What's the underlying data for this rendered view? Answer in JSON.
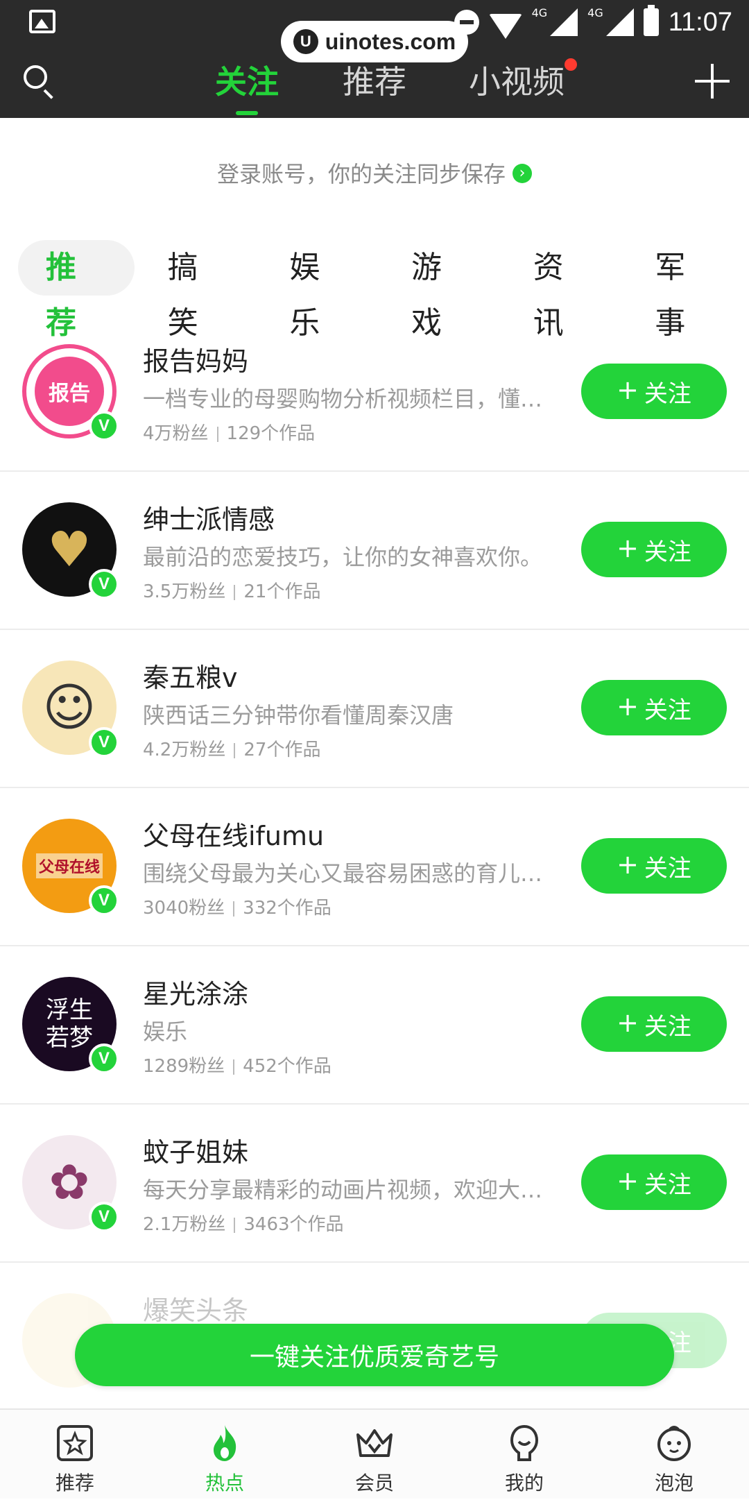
{
  "status_bar": {
    "time": "11:07",
    "net1": "4G",
    "net2": "4G"
  },
  "watermark": {
    "text": "uinotes.com"
  },
  "top_nav": {
    "tabs": [
      {
        "label": "关注",
        "active": true
      },
      {
        "label": "推荐",
        "active": false
      },
      {
        "label": "小视频",
        "active": false,
        "has_dot": true
      }
    ]
  },
  "login_banner": {
    "text": "登录账号，你的关注同步保存",
    "arrow": "›"
  },
  "categories": [
    "推荐",
    "搞笑",
    "娱乐",
    "游戏",
    "资讯",
    "军事"
  ],
  "follow_label": "关注",
  "accounts": [
    {
      "name": "报告妈妈",
      "desc": "一档专业的母婴购物分析视频栏目，懂小…",
      "fans": "4万粉丝",
      "works": "129个作品",
      "avatar_color": "#f24c8c",
      "avatar_text": "报告"
    },
    {
      "name": "绅士派情感",
      "desc": "最前沿的恋爱技巧，让你的女神喜欢你。",
      "fans": "3.5万粉丝",
      "works": "21个作品",
      "avatar_color": "#111111",
      "avatar_text": "♥"
    },
    {
      "name": "秦五粮v",
      "desc": "陕西话三分钟带你看懂周秦汉唐",
      "fans": "4.2万粉丝",
      "works": "27个作品",
      "avatar_color": "#f7e6b8",
      "avatar_text": "☺"
    },
    {
      "name": "父母在线ifumu",
      "desc": "围绕父母最为关心又最容易困惑的育儿难…",
      "fans": "3040粉丝",
      "works": "332个作品",
      "avatar_color": "#f39c12",
      "avatar_text": "父母在线"
    },
    {
      "name": "星光涂涂",
      "desc": "娱乐",
      "fans": "1289粉丝",
      "works": "452个作品",
      "avatar_color": "#3a1a4a",
      "avatar_text": "浮生若梦"
    },
    {
      "name": "蚊子姐妹",
      "desc": "每天分享最精彩的动画片视频，欢迎大家…",
      "fans": "2.1万粉丝",
      "works": "3463个作品",
      "avatar_color": "#f3e9ef",
      "avatar_text": "✿"
    },
    {
      "name": "爆笑头条",
      "desc": "",
      "fans": "",
      "works": "",
      "avatar_color": "#f7e6b8",
      "avatar_text": ""
    }
  ],
  "one_key_follow": {
    "label": "一键关注优质爱奇艺号"
  },
  "bottom_tabs": [
    {
      "label": "推荐",
      "icon": "star-box-icon"
    },
    {
      "label": "热点",
      "icon": "flame-icon",
      "active": true
    },
    {
      "label": "会员",
      "icon": "crown-icon"
    },
    {
      "label": "我的",
      "icon": "person-icon"
    },
    {
      "label": "泡泡",
      "icon": "bubble-face-icon"
    }
  ],
  "colors": {
    "accent": "#23d33a",
    "topbar": "#2b2b2b",
    "badge": "#ff3b30"
  }
}
